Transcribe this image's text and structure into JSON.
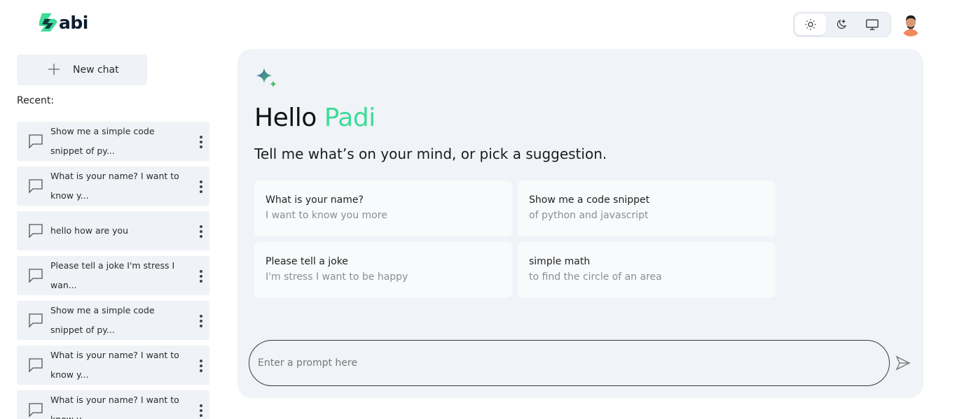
{
  "brand": {
    "logo_text": "abi",
    "accent": "#3ddc97"
  },
  "theme": {
    "options": [
      "sun-icon",
      "moon-icon",
      "monitor-icon"
    ],
    "active": "sun-icon"
  },
  "sidebar": {
    "new_chat_label": "New chat",
    "recent_label": "Recent:",
    "items": [
      {
        "label": "Show me a simple code snippet of py..."
      },
      {
        "label": "What is your name? I want to know y..."
      },
      {
        "label": "hello how are you"
      },
      {
        "label": "Please tell a joke I'm stress I wan..."
      },
      {
        "label": "Show me a simple code snippet of py..."
      },
      {
        "label": "What is your name? I want to know y..."
      },
      {
        "label": "What is your name? I want to know y..."
      }
    ]
  },
  "main": {
    "greeting": "Hello",
    "user_name": "Padi",
    "subtitle": "Tell me what’s on your mind, or pick a suggestion.",
    "suggestions": [
      {
        "title": "What is your name?",
        "subtitle": "I want to know you more"
      },
      {
        "title": "Show me a code snippet",
        "subtitle": "of python and javascript"
      },
      {
        "title": "Please tell a joke",
        "subtitle": "I'm stress I want to be happy"
      },
      {
        "title": "simple math",
        "subtitle": "to find the circle of an area"
      }
    ],
    "prompt_placeholder": "Enter a prompt here"
  }
}
